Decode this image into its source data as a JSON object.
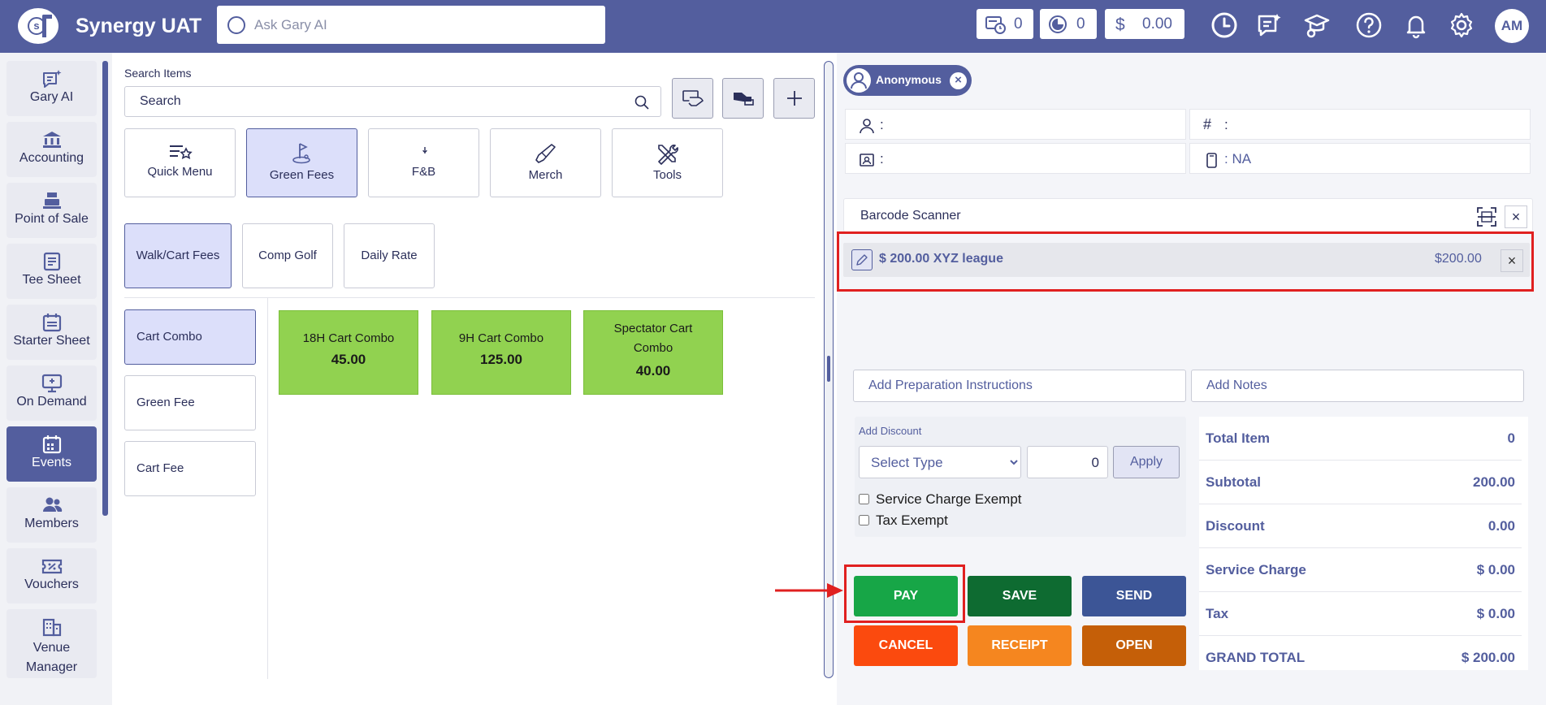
{
  "header": {
    "app_title": "Synergy UAT",
    "ask_placeholder": "Ask Gary AI",
    "stats": [
      {
        "icon": "register-clock-icon",
        "value": "0"
      },
      {
        "icon": "pie-chart-icon",
        "value": "0"
      },
      {
        "icon": "dollar-icon",
        "value": "0.00"
      }
    ],
    "dollar_sign": "$",
    "avatar_initials": "AM"
  },
  "sidebar": {
    "items": [
      {
        "label": "Gary AI",
        "icon": "ai-chat-icon"
      },
      {
        "label": "Accounting",
        "icon": "bank-icon"
      },
      {
        "label": "Point of Sale",
        "icon": "register-icon"
      },
      {
        "label": "Tee Sheet",
        "icon": "sheet-icon"
      },
      {
        "label": "Starter Sheet",
        "icon": "calendar-icon"
      },
      {
        "label": "On Demand",
        "icon": "monitor-icon"
      },
      {
        "label": "Events",
        "icon": "events-calendar-icon",
        "active": true
      },
      {
        "label": "Members",
        "icon": "members-icon"
      },
      {
        "label": "Vouchers",
        "icon": "voucher-icon"
      },
      {
        "label": "Venue",
        "label2": "Manager",
        "icon": "building-icon"
      }
    ]
  },
  "items": {
    "search_label": "Search Items",
    "search_placeholder": "Search",
    "categories": [
      {
        "label": "Quick Menu",
        "icon": "quick-menu-icon"
      },
      {
        "label": "Green Fees",
        "icon": "golf-flag-icon",
        "active": true
      },
      {
        "label": "F&B",
        "icon": "food-icon"
      },
      {
        "label": "Merch",
        "icon": "golf-club-icon"
      },
      {
        "label": "Tools",
        "icon": "tools-icon"
      }
    ],
    "subcategories": [
      {
        "label": "Walk/Cart Fees",
        "active": true
      },
      {
        "label": "Comp Golf"
      },
      {
        "label": "Daily Rate"
      }
    ],
    "groups": [
      {
        "label": "Cart Combo",
        "active": true
      },
      {
        "label": "Green Fee"
      },
      {
        "label": "Cart Fee"
      }
    ],
    "products": [
      {
        "name": "18H Cart Combo",
        "price": "45.00"
      },
      {
        "name": "9H Cart Combo",
        "price": "125.00"
      },
      {
        "name": "Spectator Cart Combo",
        "price": "40.00"
      }
    ]
  },
  "order": {
    "customer_name": "Anonymous",
    "customer_close": "×",
    "info": {
      "person": ":",
      "number": ":",
      "id_card": ":",
      "phone": ": NA"
    },
    "barcode_label": "Barcode Scanner",
    "close_glyph": "×",
    "line_items": [
      {
        "description": "$ 200.00 XYZ league",
        "amount": "$200.00"
      }
    ],
    "prep_placeholder": "Add Preparation Instructions",
    "notes_placeholder": "Add Notes",
    "discount": {
      "label": "Add Discount",
      "type_placeholder": "Select Type",
      "amount": "0",
      "apply_label": "Apply"
    },
    "service_charge_exempt": "Service Charge Exempt",
    "tax_exempt": "Tax Exempt",
    "actions": {
      "pay": "PAY",
      "save": "SAVE",
      "send": "SEND",
      "cancel": "CANCEL",
      "receipt": "RECEIPT",
      "open": "OPEN"
    },
    "action_colors": {
      "pay": "#17a647",
      "save": "#0e6b31",
      "send": "#3c5596",
      "cancel": "#fb4a0e",
      "receipt": "#f5861f",
      "open": "#c55f08"
    },
    "totals": [
      {
        "label": "Total Item",
        "value": "0"
      },
      {
        "label": "Subtotal",
        "value": "200.00"
      },
      {
        "label": "Discount",
        "value": "0.00"
      },
      {
        "label": "Service Charge",
        "value": "$ 0.00"
      },
      {
        "label": "Tax",
        "value": "$ 0.00"
      },
      {
        "label": "GRAND TOTAL",
        "value": "$ 200.00"
      }
    ]
  },
  "colors": {
    "brand": "#535e9e",
    "product_tile": "#91d250",
    "highlight": "#e02020"
  }
}
